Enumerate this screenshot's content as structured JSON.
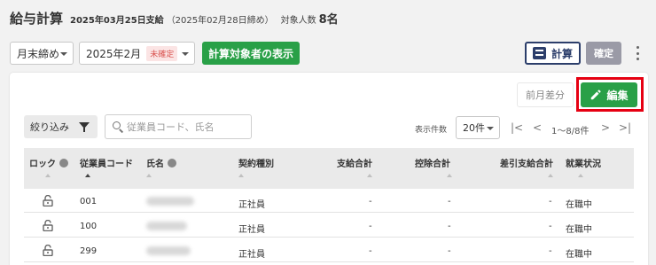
{
  "header": {
    "title": "給与計算",
    "pay_date": "2025年03月25日支給",
    "closing_date": "（2025年02月28日締め）",
    "target_label": "対象人数",
    "target_count": "8名"
  },
  "toolbar": {
    "closing_select": "月末締め",
    "month_select": "2025年2月",
    "status_badge": "未確定",
    "show_targets_label": "計算対象者の表示",
    "calc_label": "計算",
    "confirm_label": "確定"
  },
  "actions": {
    "prev_diff_label": "前月差分",
    "edit_label": "編集"
  },
  "filter": {
    "label": "絞り込み",
    "search_placeholder": "従業員コード、氏名"
  },
  "pagination": {
    "per_page_label": "表示件数",
    "per_page_value": "20件",
    "range": "1〜8/8件",
    "first": "|<",
    "prev": "<",
    "next": ">",
    "last": ">|"
  },
  "table": {
    "columns": {
      "lock": "ロック",
      "code": "従業員コード",
      "name": "氏名",
      "contract": "契約種別",
      "pay_total": "支給合計",
      "deduction_total": "控除合計",
      "net_total": "差引支給合計",
      "status": "就業状況"
    },
    "rows": [
      {
        "code": "001",
        "contract": "正社員",
        "pay_total": "-",
        "deduction_total": "-",
        "net_total": "-",
        "status": "在職中"
      },
      {
        "code": "100",
        "contract": "正社員",
        "pay_total": "-",
        "deduction_total": "-",
        "net_total": "-",
        "status": "在職中"
      },
      {
        "code": "299",
        "contract": "正社員",
        "pay_total": "-",
        "deduction_total": "-",
        "net_total": "-",
        "status": "在職中"
      }
    ]
  },
  "icons": [
    "calculator-icon",
    "kebab-icon",
    "pencil-icon",
    "funnel-icon",
    "search-icon",
    "info-icon",
    "lock-icon"
  ],
  "colors": {
    "primary_green": "#29a047",
    "highlight_red": "#e60012",
    "calc_navy": "#2c3e6b",
    "badge_red": "#d9534f"
  }
}
